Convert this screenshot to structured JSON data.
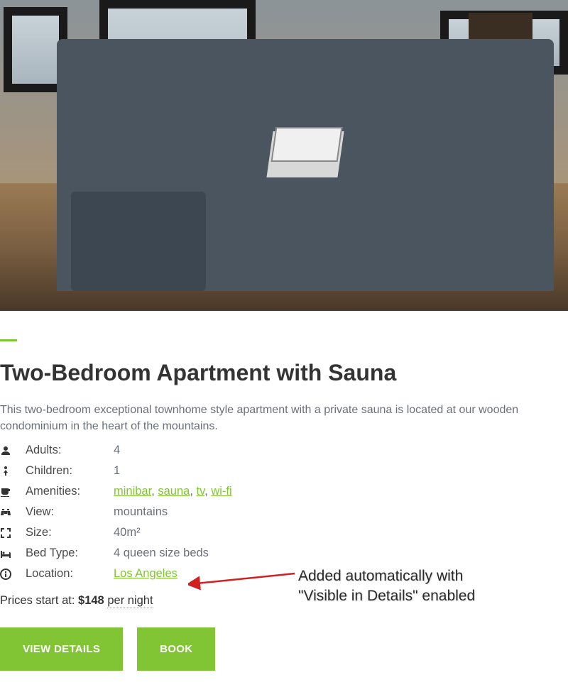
{
  "title": "Two-Bedroom Apartment with Sauna",
  "description": "This two-bedroom exceptional townhome style apartment with a private sauna is located at our wooden condominium in the heart of the mountains.",
  "details": {
    "adults": {
      "label": "Adults:",
      "value": "4"
    },
    "children": {
      "label": "Children:",
      "value": "1"
    },
    "amenities": {
      "label": "Amenities:",
      "items": [
        "minibar",
        "sauna",
        "tv",
        "wi-fi"
      ]
    },
    "view": {
      "label": "View:",
      "value": "mountains"
    },
    "size": {
      "label": "Size:",
      "value": "40m²"
    },
    "bedtype": {
      "label": "Bed Type:",
      "value": "4 queen size beds"
    },
    "location": {
      "label": "Location:",
      "value": "Los Angeles"
    }
  },
  "price": {
    "prefix": "Prices start at: ",
    "amount": "$148",
    "per_night": "per night"
  },
  "buttons": {
    "view_details": "VIEW DETAILS",
    "book": "BOOK"
  },
  "annotation": {
    "line1": "Added automatically with",
    "line2": "\"Visible in Details\" enabled"
  }
}
